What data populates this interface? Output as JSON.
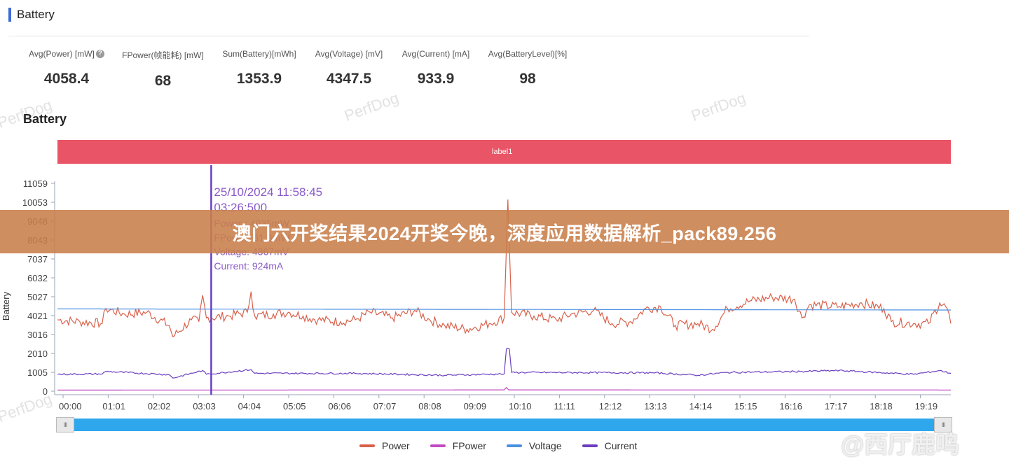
{
  "header": {
    "title": "Battery"
  },
  "stats": [
    {
      "label": "Avg(Power) [mW]",
      "value": "4058.4",
      "help": true
    },
    {
      "label": "FPower(帧能耗) [mW]",
      "value": "68"
    },
    {
      "label": "Sum(Battery)[mWh]",
      "value": "1353.9"
    },
    {
      "label": "Avg(Voltage) [mV]",
      "value": "4347.5"
    },
    {
      "label": "Avg(Current) [mA]",
      "value": "933.9"
    },
    {
      "label": "Avg(BatteryLevel)[%]",
      "value": "98"
    }
  ],
  "help_icon_glyph": "?",
  "chart_title": "Battery",
  "label_band": "label1",
  "tooltip": {
    "datetime": "25/10/2024 11:58:45",
    "elapsed": "03:26:500",
    "power": "Power : 4035mW",
    "fpower": "FPower: 61.6mW",
    "voltage": "Voltage: 4367mV",
    "current": "Current: 924mA"
  },
  "slider_handle_glyph": "III",
  "overlay": {
    "text": "澳门六开奖结果2024开奖今晚，深度应用数据解析_pack89.256"
  },
  "watermark": "PerfDog",
  "weibo": "@西厅鹿鸣",
  "chart_data": {
    "type": "line",
    "title": "Battery",
    "xlabel": "",
    "ylabel": "Battery",
    "ylim": [
      0,
      11059
    ],
    "yticks": [
      0,
      1005,
      2010,
      3016,
      4021,
      5027,
      6032,
      7037,
      8043,
      9048,
      10053,
      11059
    ],
    "xticks": [
      "00:00",
      "01:01",
      "02:02",
      "03:03",
      "04:04",
      "05:05",
      "06:06",
      "07:07",
      "08:08",
      "09:09",
      "10:10",
      "11:11",
      "12:12",
      "13:13",
      "14:14",
      "15:15",
      "16:16",
      "17:17",
      "18:18",
      "19:19"
    ],
    "x_range_minutes": [
      0,
      1200
    ],
    "grid": false,
    "legend": "bottom-center",
    "cursor_x_minutes": 206.5,
    "series": [
      {
        "name": "Power",
        "color": "#d9614a",
        "points": [
          [
            0,
            3800
          ],
          [
            30,
            3700
          ],
          [
            60,
            3600
          ],
          [
            65,
            4400
          ],
          [
            90,
            4100
          ],
          [
            120,
            4200
          ],
          [
            150,
            3500
          ],
          [
            155,
            2900
          ],
          [
            180,
            3800
          ],
          [
            190,
            3700
          ],
          [
            195,
            5100
          ],
          [
            200,
            3900
          ],
          [
            230,
            4000
          ],
          [
            255,
            4200
          ],
          [
            260,
            5300
          ],
          [
            265,
            4000
          ],
          [
            290,
            4100
          ],
          [
            310,
            4200
          ],
          [
            330,
            4000
          ],
          [
            350,
            3800
          ],
          [
            380,
            3700
          ],
          [
            400,
            3800
          ],
          [
            420,
            4200
          ],
          [
            450,
            3900
          ],
          [
            480,
            4300
          ],
          [
            500,
            3800
          ],
          [
            520,
            3500
          ],
          [
            550,
            3300
          ],
          [
            580,
            3600
          ],
          [
            600,
            3900
          ],
          [
            605,
            10200
          ],
          [
            610,
            4200
          ],
          [
            640,
            4000
          ],
          [
            670,
            3800
          ],
          [
            690,
            4100
          ],
          [
            720,
            4300
          ],
          [
            745,
            3600
          ],
          [
            770,
            3700
          ],
          [
            790,
            4400
          ],
          [
            810,
            4500
          ],
          [
            830,
            3500
          ],
          [
            860,
            3600
          ],
          [
            880,
            3300
          ],
          [
            900,
            4400
          ],
          [
            930,
            4800
          ],
          [
            960,
            5000
          ],
          [
            990,
            4900
          ],
          [
            1000,
            3900
          ],
          [
            1010,
            4600
          ],
          [
            1050,
            4500
          ],
          [
            1080,
            4700
          ],
          [
            1110,
            4400
          ],
          [
            1120,
            3700
          ],
          [
            1150,
            3600
          ],
          [
            1170,
            3600
          ],
          [
            1185,
            4700
          ],
          [
            1195,
            4400
          ],
          [
            1200,
            3600
          ]
        ]
      },
      {
        "name": "FPower",
        "color": "#c04bc3",
        "points": [
          [
            0,
            60
          ],
          [
            300,
            65
          ],
          [
            600,
            70
          ],
          [
            603,
            200
          ],
          [
            606,
            70
          ],
          [
            900,
            68
          ],
          [
            1200,
            65
          ]
        ]
      },
      {
        "name": "Voltage",
        "color": "#4a90e2",
        "points": [
          [
            0,
            4380
          ],
          [
            600,
            4350
          ],
          [
            1200,
            4320
          ]
        ]
      },
      {
        "name": "Current",
        "color": "#6b3fc0",
        "points": [
          [
            0,
            900
          ],
          [
            60,
            920
          ],
          [
            65,
            1050
          ],
          [
            150,
            880
          ],
          [
            155,
            700
          ],
          [
            195,
            1100
          ],
          [
            200,
            900
          ],
          [
            260,
            1150
          ],
          [
            265,
            950
          ],
          [
            400,
            950
          ],
          [
            520,
            850
          ],
          [
            600,
            920
          ],
          [
            603,
            2250
          ],
          [
            607,
            2250
          ],
          [
            610,
            1000
          ],
          [
            800,
            980
          ],
          [
            860,
            850
          ],
          [
            900,
            1000
          ],
          [
            1000,
            1050
          ],
          [
            1050,
            1100
          ],
          [
            1150,
            900
          ],
          [
            1185,
            1100
          ],
          [
            1200,
            950
          ]
        ]
      }
    ]
  }
}
